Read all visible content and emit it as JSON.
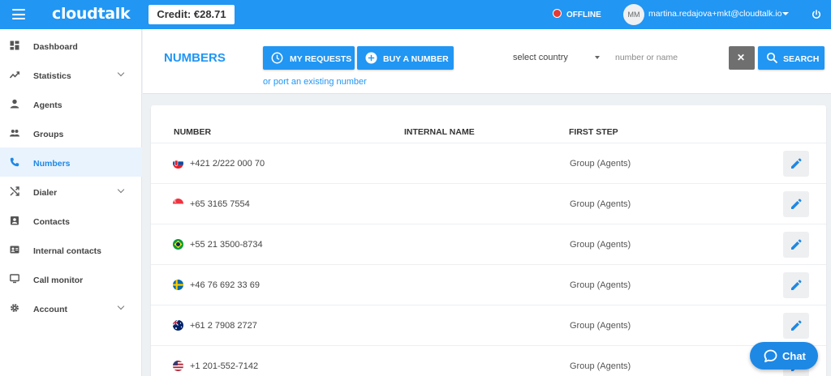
{
  "topbar": {
    "logo": "cloudtalk",
    "credit": "Credit:  €28.71",
    "status": "OFFLINE",
    "user_initials": "MM",
    "user_email": "martina.redajova+mkt@cloudtalk.io"
  },
  "sidebar": {
    "items": [
      {
        "label": "Dashboard"
      },
      {
        "label": "Statistics"
      },
      {
        "label": "Agents"
      },
      {
        "label": "Groups"
      },
      {
        "label": "Numbers"
      },
      {
        "label": "Dialer"
      },
      {
        "label": "Contacts"
      },
      {
        "label": "Internal contacts"
      },
      {
        "label": "Call monitor"
      },
      {
        "label": "Account"
      }
    ],
    "active": "Numbers"
  },
  "header": {
    "title": "NUMBERS",
    "my_requests": "MY REQUESTS",
    "buy_number": "BUY A NUMBER",
    "port_link": "or port an existing number",
    "country_select": "select country",
    "search_placeholder": "number or name",
    "clear_symbol": "✕",
    "search_button": "SEARCH"
  },
  "table": {
    "columns": [
      "NUMBER",
      "INTERNAL NAME",
      "FIRST STEP"
    ],
    "rows": [
      {
        "flag": "slovakia-flag-icon",
        "number": "+421 2/222 000 70",
        "internal_name": "",
        "first_step": "Group (Agents)"
      },
      {
        "flag": "singapore-flag-icon",
        "number": "+65 3165 7554",
        "internal_name": "",
        "first_step": "Group (Agents)"
      },
      {
        "flag": "brazil-flag-icon",
        "number": "+55 21 3500-8734",
        "internal_name": "",
        "first_step": "Group (Agents)"
      },
      {
        "flag": "sweden-flag-icon",
        "number": "+46 76 692 33 69",
        "internal_name": "",
        "first_step": "Group (Agents)"
      },
      {
        "flag": "australia-flag-icon",
        "number": "+61 2 7908 2727",
        "internal_name": "",
        "first_step": "Group (Agents)"
      },
      {
        "flag": "usa-flag-icon",
        "number": "+1 201-552-7142",
        "internal_name": "",
        "first_step": "Group (Agents)"
      }
    ]
  },
  "chat": {
    "label": "Chat"
  },
  "colors": {
    "primary": "#2196f3",
    "sidebar_active_bg": "#e9f3fd",
    "offline": "#e53935"
  }
}
